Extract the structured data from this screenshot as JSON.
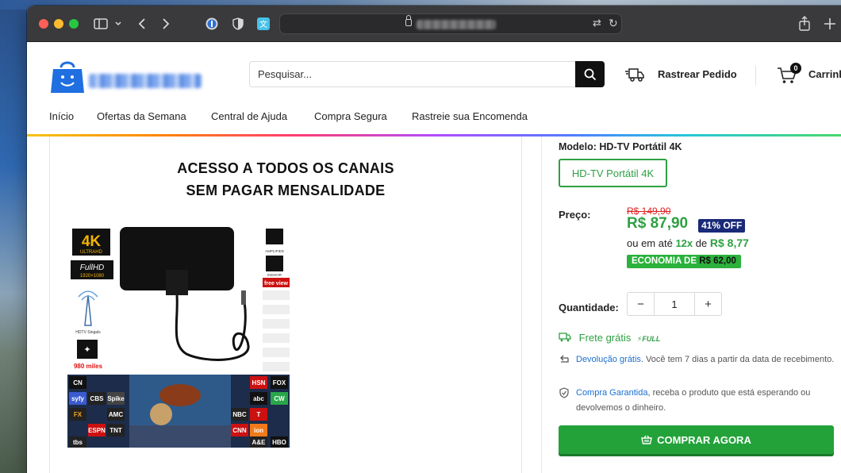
{
  "browser": {
    "traffic_lights": [
      "close",
      "minimize",
      "zoom"
    ],
    "toolbar_icons": [
      "sidebar-icon",
      "chevron-down-icon",
      "back-icon",
      "forward-icon",
      "password-icon",
      "shield-icon",
      "translate-extension-icon",
      "share-icon",
      "new-tab-icon"
    ],
    "address_text_blurred": true
  },
  "header": {
    "search_placeholder": "Pesquisar...",
    "track_order_label": "Rastrear Pedido",
    "cart_label": "Carrinho",
    "cart_count": "0"
  },
  "nav": {
    "items": [
      {
        "label": "Início"
      },
      {
        "label": "Ofertas da Semana"
      },
      {
        "label": "Central de Ajuda"
      },
      {
        "label": "Compra Segura"
      },
      {
        "label": "Rastreie sua Encomenda"
      }
    ]
  },
  "media": {
    "promo_line1": "ACESSO A TODOS OS CANAIS",
    "promo_line2": "SEM PAGAR MENSALIDADE",
    "badges": [
      "4K",
      "ULTRAHD",
      "FullHD",
      "1920×1080",
      "HDTV Singals",
      "980 miles",
      "AMPLIFIED",
      "INDOOR",
      "free view"
    ],
    "channel_logos": [
      "CN",
      "syfy",
      "CBS",
      "Spike",
      "FX",
      "AMC",
      "ESPN",
      "TNT",
      "HSN",
      "FOX",
      "CW",
      "abc",
      "NBC",
      "T",
      "CNN",
      "ion",
      "tbs",
      "A&E",
      "HBO"
    ]
  },
  "product": {
    "model_label": "Modelo:",
    "model_value": "HD-TV Portátil 4K",
    "variant": "HD-TV Portátil 4K",
    "price_label": "Preço:",
    "old_price": "R$ 149,90",
    "new_price": "R$ 87,90",
    "discount_badge": "41% OFF",
    "installment_prefix": "ou em até",
    "installment_count": "12x",
    "installment_mid": "de",
    "installment_value": "R$ 8,77",
    "economy_prefix": "ECONOMIA DE",
    "economy_value": "R$ 62,00",
    "quantity_label": "Quantidade:",
    "quantity_value": "1",
    "minus": "−",
    "plus": "+",
    "shipping_label": "Frete grátis",
    "shipping_badge": "FULL",
    "return_link": "Devolução grátis",
    "return_text": ". Você tem 7 dias a partir da data de recebimento.",
    "guarantee_link": "Compra Garantida",
    "guarantee_text": ", receba o produto que está esperando ou devolvemos o dinheiro.",
    "buy_label": "COMPRAR AGORA"
  },
  "colors": {
    "accent_green": "#2ea043",
    "buy_green": "#23a23a",
    "old_price_red": "#e02020",
    "badge_navy": "#1a2a78",
    "link_blue": "#1a6fd1",
    "logo_blue": "#1f6fe0"
  }
}
